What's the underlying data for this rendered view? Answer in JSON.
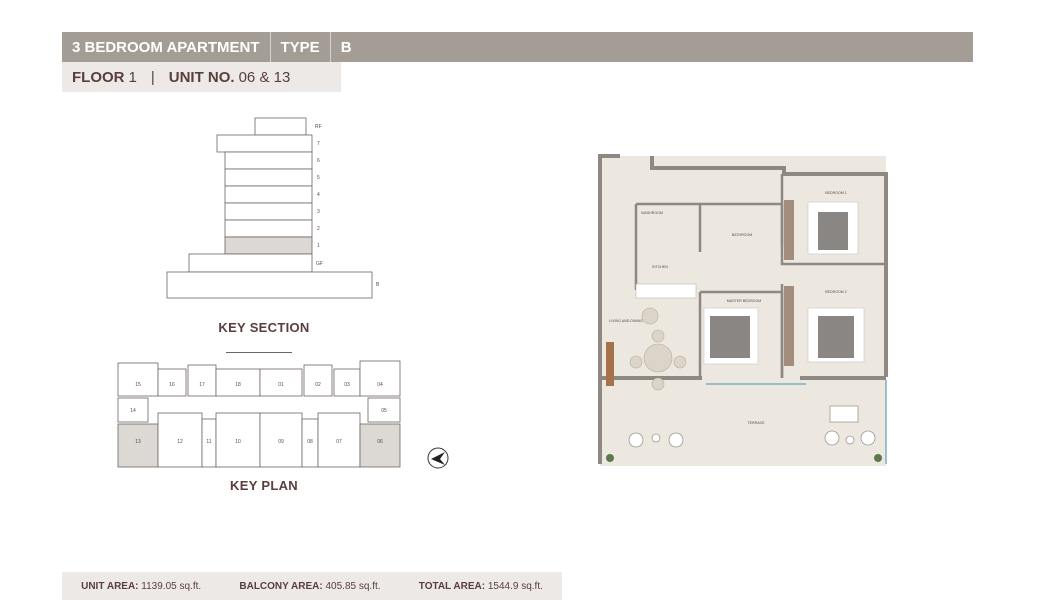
{
  "header": {
    "apartment": "3 BEDROOM APARTMENT",
    "type_label": "TYPE",
    "type_value": "B"
  },
  "subheader": {
    "floor_label": "FLOOR",
    "floor_value": "1",
    "divider": "|",
    "unit_label": "UNIT NO.",
    "unit_value": "06 & 13"
  },
  "key_section": {
    "title": "KEY SECTION",
    "floors": [
      "RF",
      "7",
      "6",
      "5",
      "4",
      "3",
      "2",
      "1",
      "GF",
      "B"
    ],
    "highlighted_floor": "1"
  },
  "key_plan": {
    "title": "KEY PLAN",
    "top_units": [
      "15",
      "16",
      "17",
      "18",
      "01",
      "02",
      "03",
      "04"
    ],
    "mid_units": [
      "14",
      "05"
    ],
    "bottom_units": [
      "13",
      "12",
      "11",
      "10",
      "09",
      "08",
      "07",
      "06"
    ],
    "highlighted_units": [
      "13",
      "06"
    ]
  },
  "floor_plan": {
    "rooms": {
      "bedroom1": "BEDROOM 1",
      "bedroom2": "BEDROOM 2",
      "bathroom": "BATHROOM",
      "washroom": "WASHROOM",
      "kitchen": "KITCHEN",
      "master_bedroom": "MASTER BEDROOM",
      "living_dining": "LIVING AND DINING",
      "terrace": "TERRACE"
    }
  },
  "footer": {
    "unit_area_label": "UNIT AREA:",
    "unit_area_value": "1139.05 sq.ft.",
    "balcony_area_label": "BALCONY AREA:",
    "balcony_area_value": "405.85 sq.ft.",
    "total_area_label": "TOTAL AREA:",
    "total_area_value": "1544.9 sq.ft."
  },
  "colors": {
    "header_bg": "#a49d96",
    "subheader_bg": "#ece9e6",
    "title_text": "#5a3e3e",
    "highlight": "#dcd8d3",
    "wall": "#8f8782",
    "floor": "#ece7df"
  }
}
